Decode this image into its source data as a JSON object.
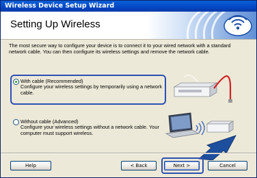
{
  "window": {
    "title": "Wireless Device Setup Wizard"
  },
  "banner": {
    "heading": "Setting Up Wireless"
  },
  "description": "The most secure way to configure your device is to connect it to your wired network with a standard network cable. You can then configure its wireless settings and remove the network cable.",
  "options": [
    {
      "title": "With cable (Recommended)",
      "description": "Configure your wireless settings by temporarily using a network cable.",
      "selected": true
    },
    {
      "title": "Without cable (Advanced)",
      "description": "Configure your wireless settings without a network cable. Your computer must support wireless.",
      "selected": false
    }
  ],
  "buttons": {
    "help": "Help",
    "back": "< Back",
    "next": "Next >",
    "cancel": "Cancel"
  },
  "colors": {
    "titlebar": "#0347c4",
    "highlight": "#2d4fb5",
    "arrow": "#1e4f9e",
    "cable": "#d02020"
  }
}
